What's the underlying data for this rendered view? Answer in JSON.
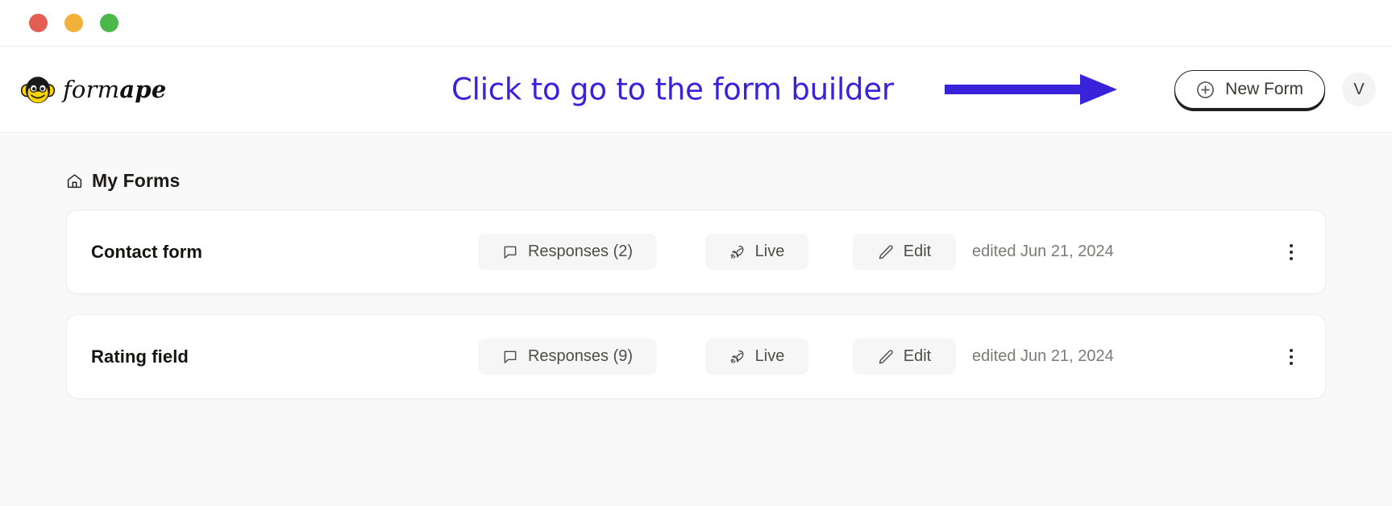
{
  "window": {
    "traffic_lights": [
      {
        "name": "close",
        "color": "#e45c52"
      },
      {
        "name": "minimize",
        "color": "#f3b13c"
      },
      {
        "name": "zoom",
        "color": "#4cb84c"
      }
    ]
  },
  "header": {
    "brand": {
      "name_prefix": "form",
      "name_suffix": "ape",
      "logo_icon": "monkey-face-icon"
    },
    "annotation": {
      "text": "Click to go to the form builder",
      "color": "#3823db",
      "arrow_icon": "right-arrow-icon"
    },
    "new_form_button": {
      "label": "New Form",
      "icon": "plus-circle-icon"
    },
    "avatar": {
      "initial": "V"
    }
  },
  "main": {
    "page_title": "My Forms",
    "page_title_icon": "home-icon",
    "forms": [
      {
        "name": "Contact form",
        "responses_label": "Responses (2)",
        "responses_icon": "message-square-icon",
        "live_label": "Live",
        "live_icon": "rocket-icon",
        "edit_label": "Edit",
        "edit_icon": "pencil-icon",
        "edited_label": "edited Jun 21, 2024",
        "menu_icon": "more-vertical-icon"
      },
      {
        "name": "Rating field",
        "responses_label": "Responses (9)",
        "responses_icon": "message-square-icon",
        "live_label": "Live",
        "live_icon": "rocket-icon",
        "edit_label": "Edit",
        "edit_icon": "pencil-icon",
        "edited_label": "edited Jun 21, 2024",
        "menu_icon": "more-vertical-icon"
      }
    ]
  }
}
